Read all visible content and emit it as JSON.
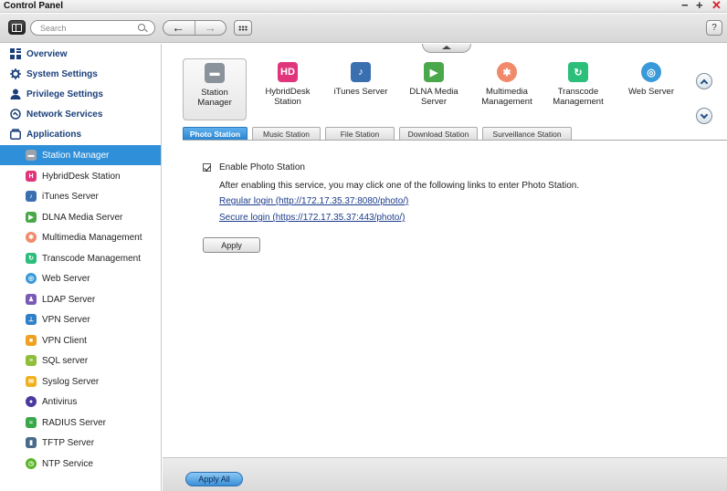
{
  "window": {
    "title": "Control Panel",
    "controls": {
      "minimize": "−",
      "maximize": "+",
      "close": "✕"
    }
  },
  "toolbar": {
    "search_placeholder": "Search",
    "back": "←",
    "forward": "→",
    "help": "?"
  },
  "sidebar": {
    "categories": [
      {
        "label": "Overview",
        "icon": "overview-icon"
      },
      {
        "label": "System Settings",
        "icon": "gear-icon"
      },
      {
        "label": "Privilege Settings",
        "icon": "user-icon"
      },
      {
        "label": "Network Services",
        "icon": "network-icon"
      },
      {
        "label": "Applications",
        "icon": "applications-icon"
      }
    ],
    "items": [
      {
        "label": "Station Manager",
        "icon": "station-manager-icon",
        "color": "#9aa3ad",
        "active": true
      },
      {
        "label": "HybridDesk Station",
        "icon": "hybriddesk-icon",
        "color": "#e0357a"
      },
      {
        "label": "iTunes Server",
        "icon": "itunes-icon",
        "color": "#3a6fb0"
      },
      {
        "label": "DLNA Media Server",
        "icon": "dlna-icon",
        "color": "#4aa84a"
      },
      {
        "label": "Multimedia Management",
        "icon": "multimedia-icon",
        "color": "#f08a6a"
      },
      {
        "label": "Transcode Management",
        "icon": "transcode-icon",
        "color": "#2cbf7a"
      },
      {
        "label": "Web Server",
        "icon": "globe-icon",
        "color": "#3a9ad9"
      },
      {
        "label": "LDAP Server",
        "icon": "ldap-icon",
        "color": "#7a5ab5"
      },
      {
        "label": "VPN Server",
        "icon": "vpn-server-icon",
        "color": "#2f7fc9"
      },
      {
        "label": "VPN Client",
        "icon": "lock-icon",
        "color": "#f0a020"
      },
      {
        "label": "SQL server",
        "icon": "database-icon",
        "color": "#8fbf3a"
      },
      {
        "label": "Syslog Server",
        "icon": "envelope-icon",
        "color": "#f0b020"
      },
      {
        "label": "Antivirus",
        "icon": "antivirus-icon",
        "color": "#4a3aa0"
      },
      {
        "label": "RADIUS Server",
        "icon": "radius-icon",
        "color": "#3aa84a"
      },
      {
        "label": "TFTP Server",
        "icon": "tftp-icon",
        "color": "#4a6a8a"
      },
      {
        "label": "NTP Service",
        "icon": "clock-icon",
        "color": "#5ab52a"
      }
    ]
  },
  "apps": [
    {
      "label": "Station Manager",
      "icon": "station-manager-icon",
      "color": "#8a929b",
      "selected": true
    },
    {
      "label": "HybridDesk\nStation",
      "icon": "hybriddesk-icon",
      "color": "#e0357a",
      "glyph": "HD"
    },
    {
      "label": "iTunes Server",
      "icon": "itunes-icon",
      "color": "#3a6fb0"
    },
    {
      "label": "DLNA Media\nServer",
      "icon": "dlna-icon",
      "color": "#4aa84a"
    },
    {
      "label": "Multimedia\nManagement",
      "icon": "multimedia-icon",
      "color": "#f08a6a"
    },
    {
      "label": "Transcode\nManagement",
      "icon": "transcode-icon",
      "color": "#2cbf7a"
    },
    {
      "label": "Web Server",
      "icon": "globe-icon",
      "color": "#3a9ad9"
    }
  ],
  "tabs": [
    "Photo Station",
    "Music Station",
    "File Station",
    "Download Station",
    "Surveillance Station"
  ],
  "photo_station": {
    "enable_label": "Enable Photo Station",
    "enabled": true,
    "description": "After enabling this service, you may click one of the following links to enter Photo Station.",
    "regular_login": "Regular login (http://172.17.35.37:8080/photo/)",
    "secure_login": "Secure login (https://172.17.35.37:443/photo/)",
    "apply": "Apply"
  },
  "footer": {
    "apply_all": "Apply All"
  }
}
